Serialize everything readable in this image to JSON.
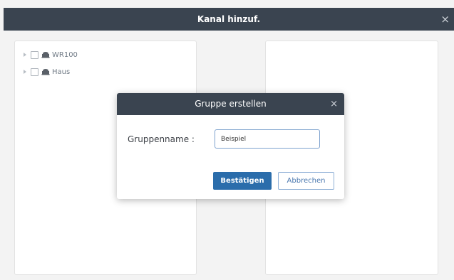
{
  "window": {
    "title": "Kanal hinzuf.",
    "close_icon": "×"
  },
  "tree": {
    "items": [
      {
        "label": "WR100"
      },
      {
        "label": "Haus"
      }
    ]
  },
  "modal": {
    "title": "Gruppe erstellen",
    "close_icon": "×",
    "field_label": "Gruppenname :",
    "field_value": "Beispiel",
    "confirm_label": "Bestätigen",
    "cancel_label": "Abbrechen"
  },
  "colors": {
    "header_bg": "#3a4450",
    "primary_button": "#2b6dab",
    "input_border": "#7ea2ce"
  }
}
